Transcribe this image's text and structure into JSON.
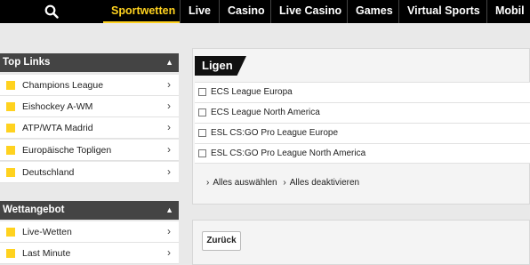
{
  "nav": {
    "items": [
      "Sportwetten",
      "Live",
      "Casino",
      "Live Casino",
      "Games",
      "Virtual Sports",
      "Mobil"
    ],
    "active": "Sportwetten",
    "accent": "#ffd21f"
  },
  "sidebar": {
    "top_links": {
      "title": "Top Links",
      "items": [
        "Champions League",
        "Eishockey A-WM",
        "ATP/WTA Madrid",
        "Europäische Topligen",
        "Deutschland"
      ]
    },
    "wettangebot": {
      "title": "Wettangebot",
      "items": [
        "Live-Wetten",
        "Last Minute"
      ]
    }
  },
  "main": {
    "tab_title": "Ligen",
    "leagues": [
      "ECS League Europa",
      "ECS League North America",
      "ESL CS:GO Pro League Europe",
      "ESL CS:GO Pro League North America"
    ],
    "select_all": "Alles auswählen",
    "deselect_all": "Alles deaktivieren",
    "back_label": "Zurück"
  }
}
